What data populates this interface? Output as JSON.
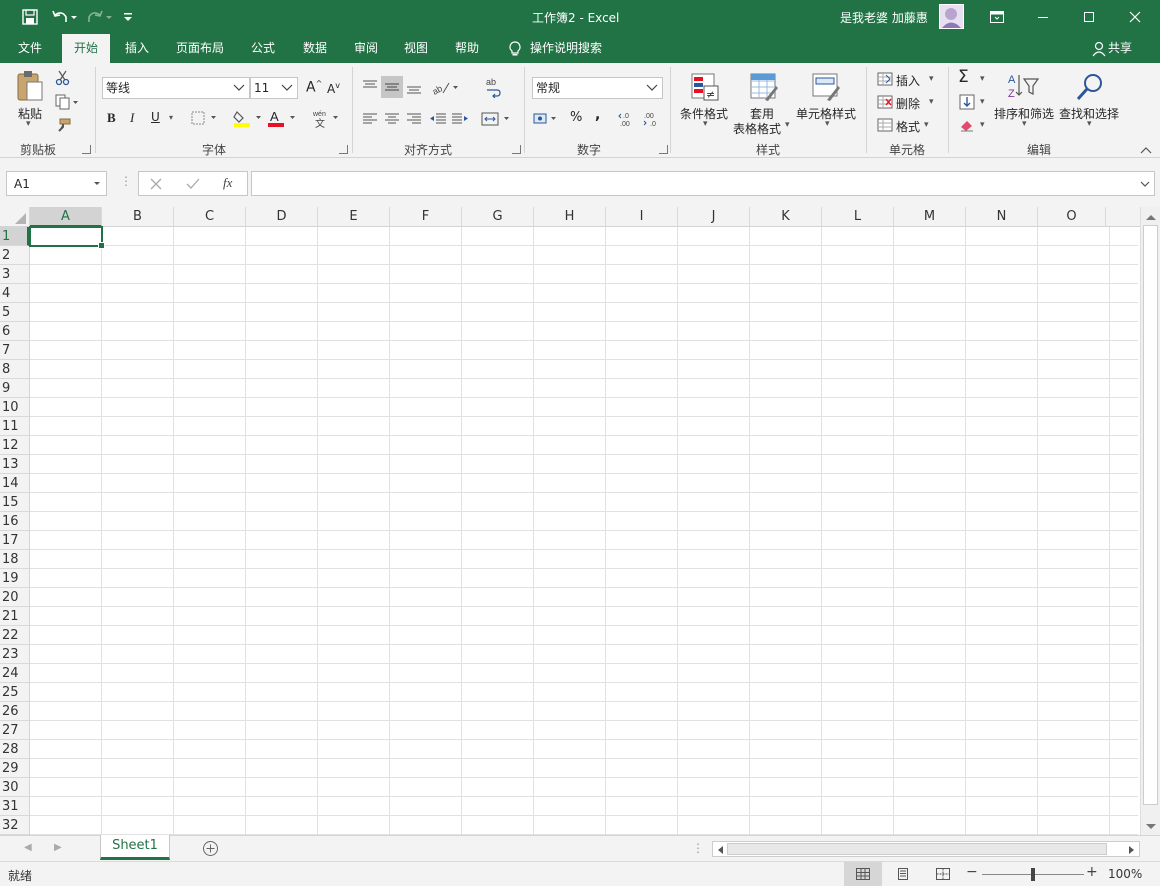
{
  "title_bar": {
    "title": "工作簿2  -  Excel",
    "user_name": "是我老婆 加藤惠"
  },
  "ribbon_tabs": [
    {
      "label": "文件"
    },
    {
      "label": "开始",
      "active": true
    },
    {
      "label": "插入"
    },
    {
      "label": "页面布局"
    },
    {
      "label": "公式"
    },
    {
      "label": "数据"
    },
    {
      "label": "审阅"
    },
    {
      "label": "视图"
    },
    {
      "label": "帮助"
    }
  ],
  "tell_me": "操作说明搜索",
  "share": "共享",
  "clipboard": {
    "paste": "粘贴",
    "group": "剪贴板"
  },
  "font": {
    "name": "等线",
    "size": "11",
    "bold": "B",
    "italic": "I",
    "underline": "U",
    "group": "字体",
    "font_color": "#e81123",
    "highlight_color": "#ffff00"
  },
  "alignment": {
    "group": "对齐方式"
  },
  "number": {
    "format": "常规",
    "percent": "%",
    "comma": ",",
    "group": "数字"
  },
  "styles": {
    "conditional": "条件格式",
    "table_1": "套用",
    "table_2": "表格格式",
    "cell_styles": "单元格样式",
    "group": "样式"
  },
  "cells": {
    "insert": "插入",
    "delete": "删除",
    "format": "格式",
    "group": "单元格"
  },
  "editing": {
    "sort_filter": "排序和筛选",
    "find_select": "查找和选择",
    "group": "编辑"
  },
  "formula_bar": {
    "name_box": "A1",
    "fx": "fx",
    "value": ""
  },
  "grid": {
    "columns": [
      "A",
      "B",
      "C",
      "D",
      "E",
      "F",
      "G",
      "H",
      "I",
      "J",
      "K",
      "L",
      "M",
      "N",
      "O"
    ],
    "rows": [
      "1",
      "2",
      "3",
      "4",
      "5",
      "6",
      "7",
      "8",
      "9",
      "10",
      "11",
      "12",
      "13",
      "14",
      "15",
      "16",
      "17",
      "18",
      "19",
      "20",
      "21",
      "22",
      "23",
      "24",
      "25",
      "26",
      "27",
      "28",
      "29",
      "30",
      "31",
      "32"
    ],
    "selected_cell": "A1"
  },
  "sheets": [
    {
      "name": "Sheet1",
      "active": true
    }
  ],
  "status": {
    "ready": "就绪",
    "zoom": "100%",
    "zoom_level": 1.0
  },
  "colors": {
    "brand": "#217346"
  }
}
